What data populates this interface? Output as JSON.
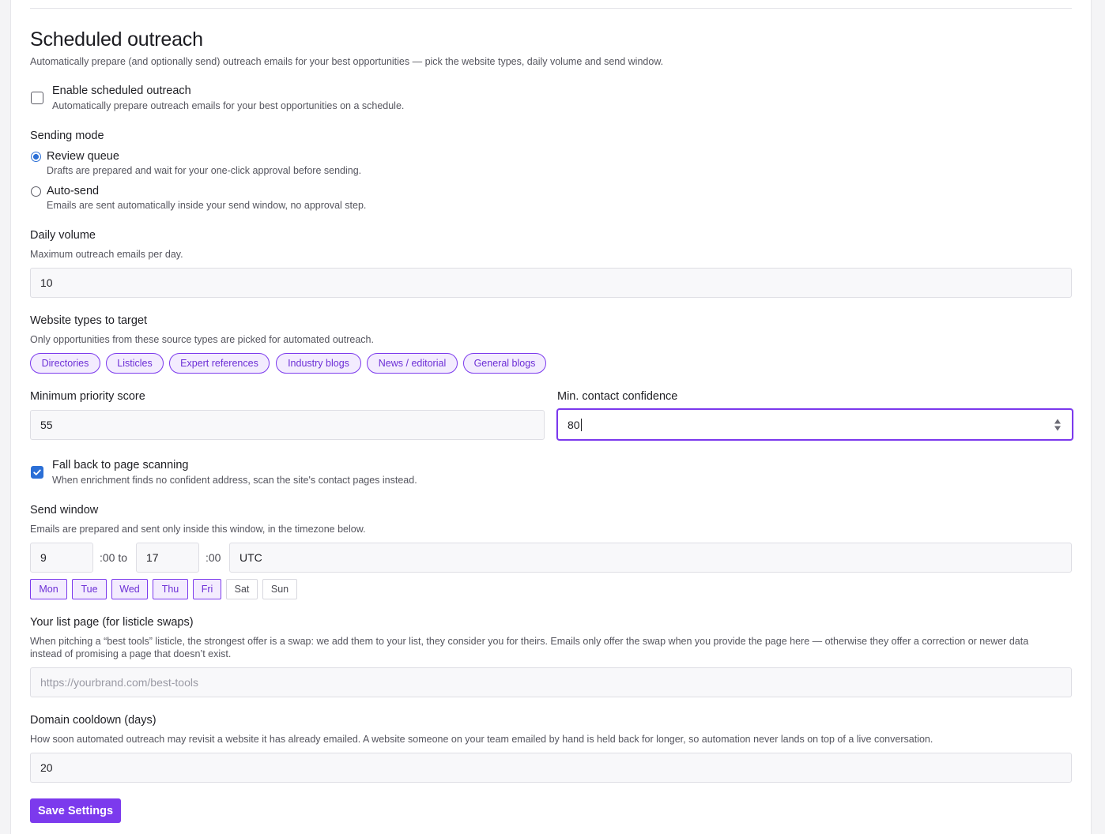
{
  "section": {
    "title": "Scheduled outreach",
    "description": "Automatically prepare (and optionally send) outreach emails for your best opportunities — pick the website types, daily volume and send window."
  },
  "enable": {
    "label": "Enable scheduled outreach",
    "help": "Automatically prepare outreach emails for your best opportunities on a schedule.",
    "checked": false
  },
  "sending_mode": {
    "label": "Sending mode",
    "options": [
      {
        "label": "Review queue",
        "help": "Drafts are prepared and wait for your one-click approval before sending.",
        "selected": true
      },
      {
        "label": "Auto-send",
        "help": "Emails are sent automatically inside your send window, no approval step.",
        "selected": false
      }
    ]
  },
  "daily_volume": {
    "label": "Daily volume",
    "help": "Maximum outreach emails per day.",
    "value": "10"
  },
  "website_types": {
    "label": "Website types to target",
    "help": "Only opportunities from these source types are picked for automated outreach.",
    "chips": [
      "Directories",
      "Listicles",
      "Expert references",
      "Industry blogs",
      "News / editorial",
      "General blogs"
    ]
  },
  "min_priority": {
    "label": "Minimum priority score",
    "value": "55"
  },
  "min_confidence": {
    "label": "Min. contact confidence",
    "value": "80"
  },
  "fallback": {
    "label": "Fall back to page scanning",
    "help": "When enrichment finds no confident address, scan the site's contact pages instead.",
    "checked": true
  },
  "send_window": {
    "label": "Send window",
    "help": "Emails are prepared and sent only inside this window, in the timezone below.",
    "start_hour": "9",
    "sep_to": ":00 to",
    "end_hour": "17",
    "sep_end": ":00",
    "timezone": "UTC",
    "days": [
      {
        "label": "Mon",
        "on": true
      },
      {
        "label": "Tue",
        "on": true
      },
      {
        "label": "Wed",
        "on": true
      },
      {
        "label": "Thu",
        "on": true
      },
      {
        "label": "Fri",
        "on": true
      },
      {
        "label": "Sat",
        "on": false
      },
      {
        "label": "Sun",
        "on": false
      }
    ]
  },
  "list_page": {
    "label": "Your list page (for listicle swaps)",
    "help_line1": "When pitching a “best tools” listicle, the strongest offer is a swap: we add them to your list, they consider you for theirs. Emails only offer the swap when you provide the page here — otherwise they offer a correction or newer data",
    "help_line2": "instead of promising a page that doesn’t exist.",
    "placeholder": "https://yourbrand.com/best-tools",
    "value": ""
  },
  "cooldown": {
    "label": "Domain cooldown (days)",
    "help": "How soon automated outreach may revisit a website it has already emailed. A website someone on your team emailed by hand is held back for longer, so automation never lands on top of a live conversation.",
    "value": "20"
  },
  "save_label": "Save Settings",
  "colors": {
    "accent": "#7c3aed",
    "accent_soft": "#f3ecfe",
    "checkbox_blue": "#2b6fd6"
  }
}
